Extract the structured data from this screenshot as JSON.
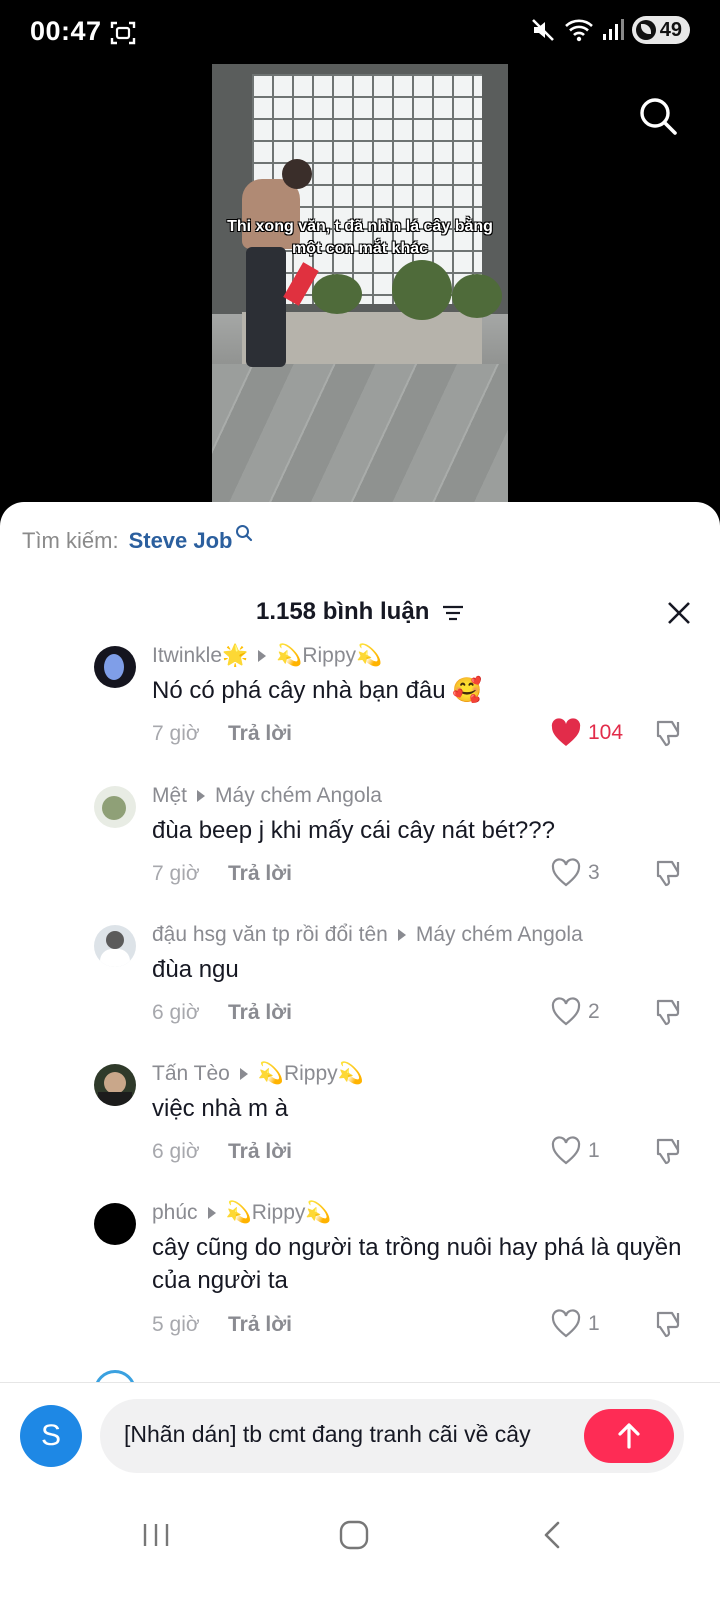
{
  "status_bar": {
    "time": "00:47",
    "battery": "49",
    "icons": [
      "screenshot-icon",
      "mute-icon",
      "wifi-icon",
      "signal-icon",
      "battery-icon"
    ]
  },
  "video": {
    "caption": "Thi xong văn, t đã nhìn lá cây bằng một con mắt khác",
    "search_icon": "search-icon"
  },
  "sheet": {
    "search_label": "Tìm kiếm:",
    "search_term": "Steve Job",
    "comment_count": "1.158 bình luận",
    "close_icon": "close-icon",
    "sort_icon": "sort-icon"
  },
  "comments": [
    {
      "author": "Itwinkle🌟",
      "reply_to": "💫Rippy💫",
      "text": "Nó có phá cây nhà bạn đâu 🥰",
      "time": "7 giờ",
      "reply_label": "Trả lời",
      "likes": "104",
      "liked": true
    },
    {
      "author": "Mệt",
      "reply_to": "Máy chém Angola",
      "text": "đùa beep j khi mấy cái cây nát bét???",
      "time": "7 giờ",
      "reply_label": "Trả lời",
      "likes": "3",
      "liked": false
    },
    {
      "author": "đậu hsg văn tp rồi đổi tên",
      "reply_to": "Máy chém Angola",
      "text": "đùa ngu",
      "time": "6 giờ",
      "reply_label": "Trả lời",
      "likes": "2",
      "liked": false
    },
    {
      "author": "Tấn Tèo",
      "reply_to": "💫Rippy💫",
      "text": "việc nhà m à",
      "time": "6 giờ",
      "reply_label": "Trả lời",
      "likes": "1",
      "liked": false
    },
    {
      "author": "phúc",
      "reply_to": "💫Rippy💫",
      "text": "cây cũng do người ta trồng nuôi hay phá là quyền của người ta",
      "time": "5 giờ",
      "reply_label": "Trả lời",
      "likes": "1",
      "liked": false
    }
  ],
  "input_bar": {
    "avatar_initial": "S",
    "draft_text": "[Nhãn dán] tb cmt đang tranh cãi về cây",
    "send_icon": "arrow-up-icon"
  },
  "colors": {
    "accent": "#fe2c55",
    "liked": "#e22c4a",
    "search_term": "#2b5f9e",
    "avatar": "#1e88e5"
  }
}
